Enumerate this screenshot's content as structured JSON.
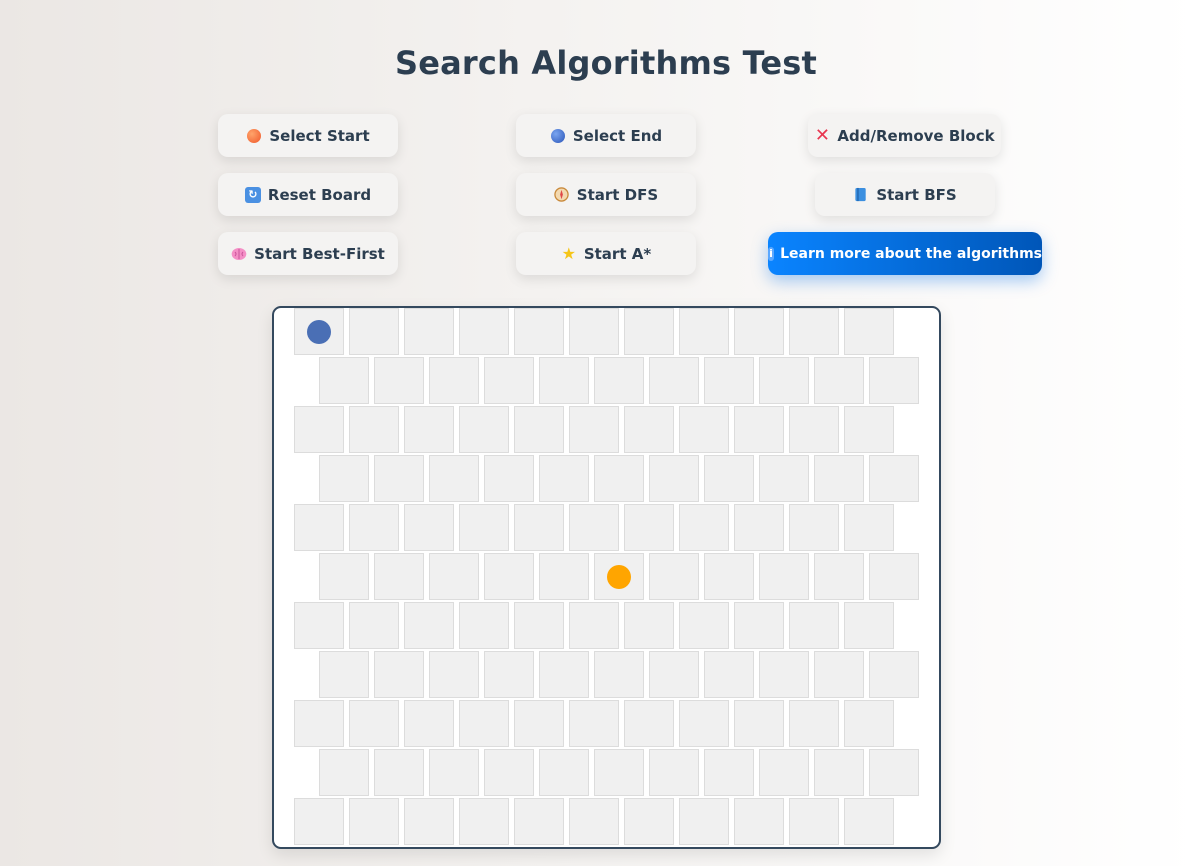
{
  "title": "Search Algorithms Test",
  "buttons": [
    {
      "id": "select-start-button",
      "label": "Select Start",
      "icon": "orange-circle-icon"
    },
    {
      "id": "select-end-button",
      "label": "Select End",
      "icon": "blue-circle-icon"
    },
    {
      "id": "add-remove-block-button",
      "label": "Add/Remove Block",
      "icon": "red-x-icon"
    },
    {
      "id": "reset-board-button",
      "label": "Reset Board",
      "icon": "refresh-icon"
    },
    {
      "id": "start-dfs-button",
      "label": "Start DFS",
      "icon": "compass-icon"
    },
    {
      "id": "start-bfs-button",
      "label": "Start BFS",
      "icon": "book-icon"
    },
    {
      "id": "start-best-first-button",
      "label": "Start Best-First",
      "icon": "brain-icon"
    },
    {
      "id": "start-astar-button",
      "label": "Start A*",
      "icon": "star-icon"
    },
    {
      "id": "learn-more-button",
      "label": "Learn more about the algorithms",
      "icon": "info-icon"
    }
  ],
  "board": {
    "rows": 11,
    "even_row_cols": 11,
    "odd_row_cols": 11,
    "start": {
      "row": 0,
      "col": 0
    },
    "end": {
      "row": 5,
      "col": 5
    }
  },
  "colors": {
    "title": "#2c3e50",
    "button_bg": "#f4f3f2",
    "primary_start": "#0a84ff",
    "primary_end": "#0056b8",
    "cell_bg": "#f0f0f0",
    "cell_border": "#dcdcdc",
    "board_border": "#34495e",
    "start_marker": "#4a6fb5",
    "end_marker": "#ffa500"
  }
}
